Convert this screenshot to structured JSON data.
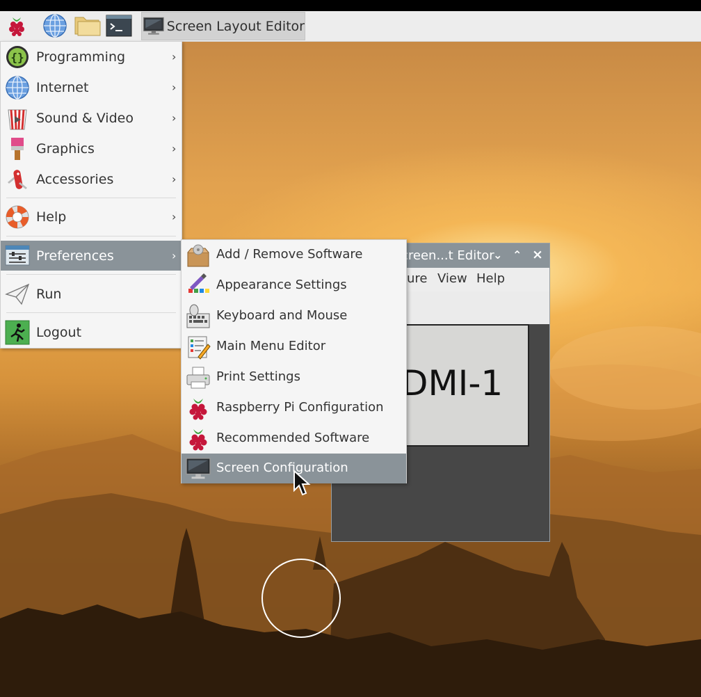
{
  "taskbar": {
    "launchers": [
      {
        "name": "raspberry-menu",
        "icon": "raspberry-icon"
      },
      {
        "name": "web-browser",
        "icon": "globe-icon"
      },
      {
        "name": "file-manager",
        "icon": "folder-icon"
      },
      {
        "name": "terminal",
        "icon": "terminal-icon"
      }
    ],
    "window_button": {
      "label": "Screen Layout Editor",
      "icon": "monitor-icon"
    }
  },
  "main_menu": {
    "items": [
      {
        "label": "Programming",
        "icon": "braces-icon",
        "has_submenu": true
      },
      {
        "label": "Internet",
        "icon": "globe-icon",
        "has_submenu": true
      },
      {
        "label": "Sound & Video",
        "icon": "popcorn-icon",
        "has_submenu": true
      },
      {
        "label": "Graphics",
        "icon": "paintbrush-icon",
        "has_submenu": true
      },
      {
        "label": "Accessories",
        "icon": "swiss-knife-icon",
        "has_submenu": true
      },
      {
        "label": "Help",
        "icon": "lifebuoy-icon",
        "has_submenu": true
      },
      {
        "label": "Preferences",
        "icon": "preferences-icon",
        "has_submenu": true,
        "selected": true
      },
      {
        "label": "Run",
        "icon": "paper-plane-icon",
        "has_submenu": false
      },
      {
        "label": "Logout",
        "icon": "exit-icon",
        "has_submenu": false
      }
    ],
    "arrow": "›"
  },
  "preferences_submenu": {
    "items": [
      {
        "label": "Add / Remove Software",
        "icon": "package-icon"
      },
      {
        "label": "Appearance Settings",
        "icon": "palette-icon"
      },
      {
        "label": "Keyboard and Mouse",
        "icon": "keyboard-mouse-icon"
      },
      {
        "label": "Main Menu Editor",
        "icon": "menu-editor-icon"
      },
      {
        "label": "Print Settings",
        "icon": "printer-icon"
      },
      {
        "label": "Raspberry Pi Configuration",
        "icon": "raspberry-icon"
      },
      {
        "label": "Recommended Software",
        "icon": "raspberry-icon"
      },
      {
        "label": "Screen Configuration",
        "icon": "monitor-icon",
        "selected": true
      }
    ]
  },
  "background_window": {
    "title": "creen...t Editor",
    "controls": {
      "minimize": "⌄",
      "maximize": "⌃",
      "close": "×"
    },
    "menubar": [
      "ure",
      "View",
      "Help"
    ],
    "monitor_label": "DMI-1"
  },
  "colors": {
    "selection": "#8a9399",
    "menu_bg": "#f5f5f5",
    "taskbar_bg": "#ededed",
    "canvas_bg": "#474747"
  }
}
